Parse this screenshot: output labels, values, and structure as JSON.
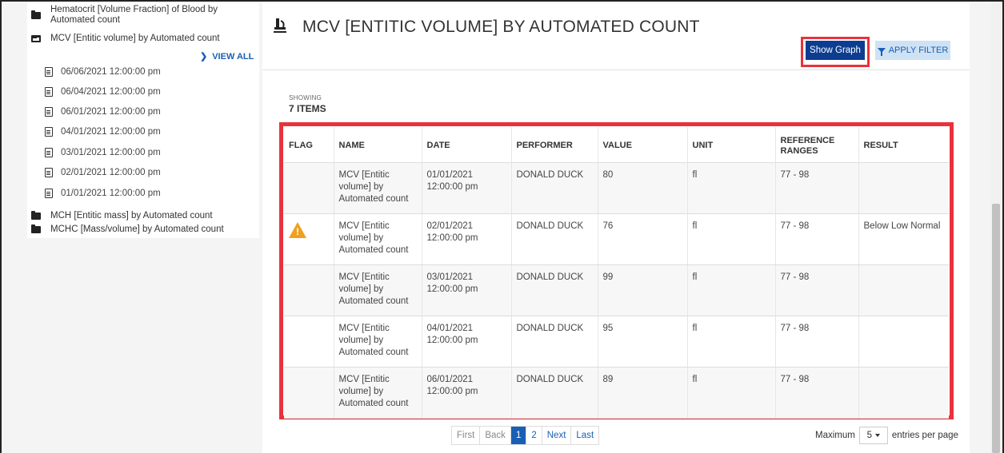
{
  "sidebar": {
    "folders_top": [
      {
        "label": "Hematocrit [Volume Fraction] of Blood by Automated count",
        "open": false
      },
      {
        "label": "MCV [Entitic volume] by Automated count",
        "open": true
      }
    ],
    "view_all": "VIEW ALL",
    "documents": [
      "06/06/2021 12:00:00 pm",
      "06/04/2021 12:00:00 pm",
      "06/01/2021 12:00:00 pm",
      "04/01/2021 12:00:00 pm",
      "03/01/2021 12:00:00 pm",
      "02/01/2021 12:00:00 pm",
      "01/01/2021 12:00:00 pm"
    ],
    "folders_bottom": [
      "MCH [Entitic mass] by Automated count",
      "MCHC [Mass/volume] by Automated count"
    ]
  },
  "main": {
    "title": "MCV [ENTITIC VOLUME] BY AUTOMATED COUNT",
    "show_graph": "Show Graph",
    "apply_filter": "APPLY FILTER",
    "showing_label": "SHOWING",
    "count_label": "7 ITEMS"
  },
  "table": {
    "headers": [
      "FLAG",
      "NAME",
      "DATE",
      "PERFORMER",
      "VALUE",
      "UNIT",
      "REFERENCE RANGES",
      "RESULT"
    ],
    "rows": [
      {
        "flag": "",
        "name": "MCV [Entitic volume] by Automated count",
        "date": "01/01/2021 12:00:00 pm",
        "performer": "DONALD DUCK",
        "value": "80",
        "unit": "fl",
        "ref": "77 - 98",
        "result": ""
      },
      {
        "flag": "warning",
        "name": "MCV [Entitic volume] by Automated count",
        "date": "02/01/2021 12:00:00 pm",
        "performer": "DONALD DUCK",
        "value": "76",
        "unit": "fl",
        "ref": "77 - 98",
        "result": "Below Low Normal"
      },
      {
        "flag": "",
        "name": "MCV [Entitic volume] by Automated count",
        "date": "03/01/2021 12:00:00 pm",
        "performer": "DONALD DUCK",
        "value": "99",
        "unit": "fl",
        "ref": "77 - 98",
        "result": ""
      },
      {
        "flag": "",
        "name": "MCV [Entitic volume] by Automated count",
        "date": "04/01/2021 12:00:00 pm",
        "performer": "DONALD DUCK",
        "value": "95",
        "unit": "fl",
        "ref": "77 - 98",
        "result": ""
      },
      {
        "flag": "",
        "name": "MCV [Entitic volume] by Automated count",
        "date": "06/01/2021 12:00:00 pm",
        "performer": "DONALD DUCK",
        "value": "89",
        "unit": "fl",
        "ref": "77 - 98",
        "result": ""
      }
    ]
  },
  "pagination": {
    "first": "First",
    "back": "Back",
    "pages": [
      "1",
      "2"
    ],
    "active_page": "1",
    "next": "Next",
    "last": "Last",
    "maximum_label": "Maximum",
    "per_page_value": "5",
    "entries_label": "entries per page"
  },
  "colors": {
    "highlight": "#e8323c",
    "primary_button": "#0d3d91",
    "filter_button": "#cfe2f4",
    "link": "#1a5fb4",
    "warning": "#f0a020"
  }
}
